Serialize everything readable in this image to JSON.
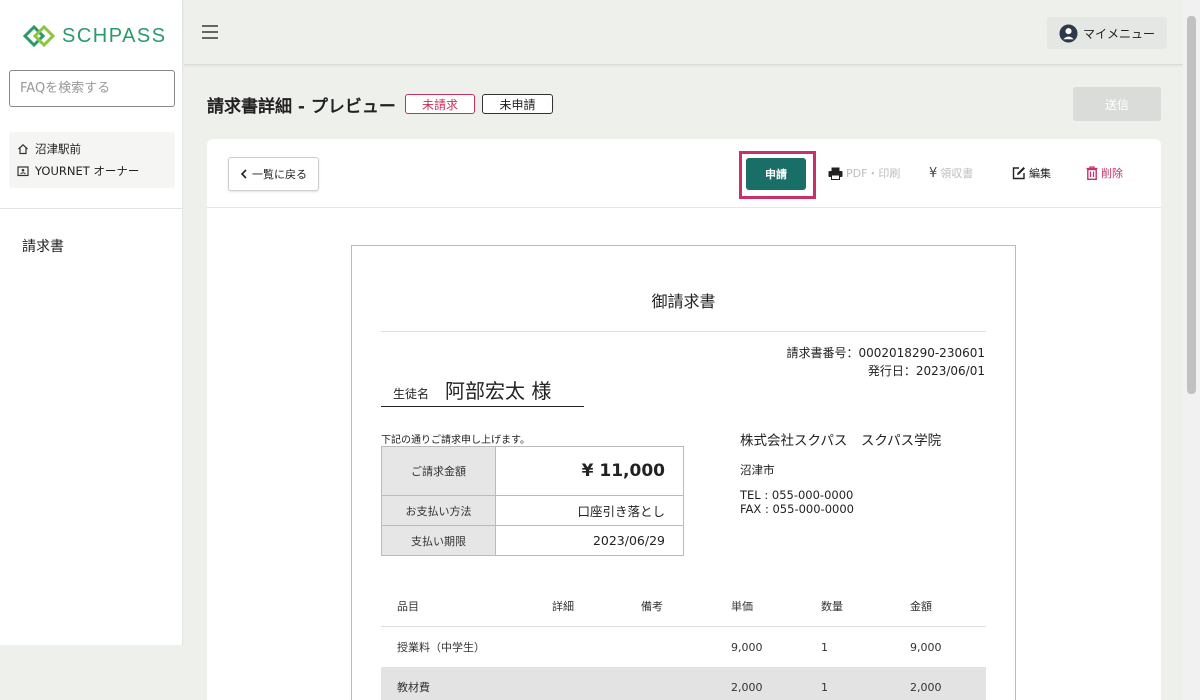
{
  "app": {
    "name": "SCHPASS"
  },
  "sidebar": {
    "search_placeholder": "FAQを検索する",
    "school": "沼津駅前",
    "account": "YOURNET オーナー",
    "nav": [
      "請求書"
    ]
  },
  "topbar": {
    "menu_label": "マイメニュー"
  },
  "page": {
    "title": "請求書詳細 - プレビュー",
    "status_unbilled": "未請求",
    "status_unapplied": "未申請",
    "send_label": "送信"
  },
  "toolbar": {
    "back_label": "一覧に戻る",
    "apply_label": "申請",
    "pdf_label": "PDF・印刷",
    "receipt_label": "領収書",
    "edit_label": "編集",
    "delete_label": "削除"
  },
  "invoice": {
    "title": "御請求書",
    "number_line": "請求書番号：0002018290-230601",
    "issue_line": "発行日：2023/06/01",
    "student_label": "生徒名",
    "student_name": "阿部宏太 様",
    "intro": "下記の通りご請求申し上げます。",
    "amount_label": "ご請求金額",
    "amount_value": "¥ 11,000",
    "method_label": "お支払い方法",
    "method_value": "口座引き落とし",
    "due_label": "支払い期限",
    "due_value": "2023/06/29",
    "company": "株式会社スクパス　スクパス学院",
    "city": "沼津市",
    "tel": "TEL : 055-000-0000",
    "fax": "FAX : 055-000-0000",
    "columns": [
      "品目",
      "詳細",
      "備考",
      "単価",
      "数量",
      "金額"
    ],
    "items": [
      {
        "name": "授業料（中学生）",
        "detail": "",
        "note": "",
        "unit_price": "9,000",
        "qty": "1",
        "amount": "9,000"
      },
      {
        "name": "教材費",
        "detail": "",
        "note": "",
        "unit_price": "2,000",
        "qty": "1",
        "amount": "2,000"
      }
    ]
  },
  "colors": {
    "brand": "#2a9a6a",
    "accent": "#1a6e68",
    "danger": "#c8306a"
  }
}
